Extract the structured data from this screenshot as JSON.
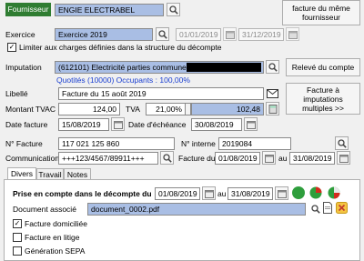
{
  "header": {
    "fournisseur_label": "Fournisseur",
    "fournisseur_value": "ENGIE ELECTRABEL",
    "same_supplier_button": "facture du même fournisseur"
  },
  "exercice": {
    "label": "Exercice",
    "value": "Exercice 2019",
    "date_from": "01/01/2019",
    "date_to": "31/12/2019"
  },
  "limit_checkbox": {
    "label": "Limiter aux charges définies dans la structure du décompte",
    "checked": true
  },
  "imputation": {
    "label": "Imputation",
    "value": "(612101) Electricité parties communes",
    "quotites": "Quotités (10000) Occupants : 100,00%",
    "releve_button": "Relevé du compte",
    "multi_button": "Facture à imputations multiples >>"
  },
  "libelle": {
    "label": "Libellé",
    "value": "Facture du 15 août 2019"
  },
  "montant": {
    "tvac_label": "Montant TVAC",
    "tvac_value": "124,00",
    "tva_label": "TVA",
    "tva_rate": "21,00%",
    "tva_value": "102,48"
  },
  "dates": {
    "facture_label": "Date facture",
    "facture_value": "15/08/2019",
    "echeance_label": "Date d'échéance",
    "echeance_value": "30/08/2019"
  },
  "numeros": {
    "facture_label": "N° Facture",
    "facture_value": "117 021 125 860",
    "interne_label": "N° interne",
    "interne_value": "2019084"
  },
  "communication": {
    "label": "Communication",
    "value": "+++123/4567/89911+++",
    "facture_du_label": "Facture du",
    "from": "01/08/2019",
    "au_label": "au",
    "to": "31/08/2019"
  },
  "tabs": [
    {
      "label": "Divers",
      "active": true
    },
    {
      "label": "Travail",
      "active": false
    },
    {
      "label": "Notes",
      "active": false
    }
  ],
  "divers": {
    "prise_label": "Prise en compte dans le décompte du",
    "prise_from": "01/08/2019",
    "au_label": "au",
    "prise_to": "31/08/2019",
    "document_label": "Document associé",
    "document_value": "document_0002.pdf",
    "options": [
      {
        "label": "Facture domiciliée",
        "checked": true
      },
      {
        "label": "Facture en litige",
        "checked": false
      },
      {
        "label": "Génération SEPA",
        "checked": false
      }
    ]
  },
  "colors": {
    "accent": "#a9bee4",
    "header_green": "#2f7d32",
    "pie_green": "#2e9e3c",
    "pie_red": "#d42b1e"
  }
}
